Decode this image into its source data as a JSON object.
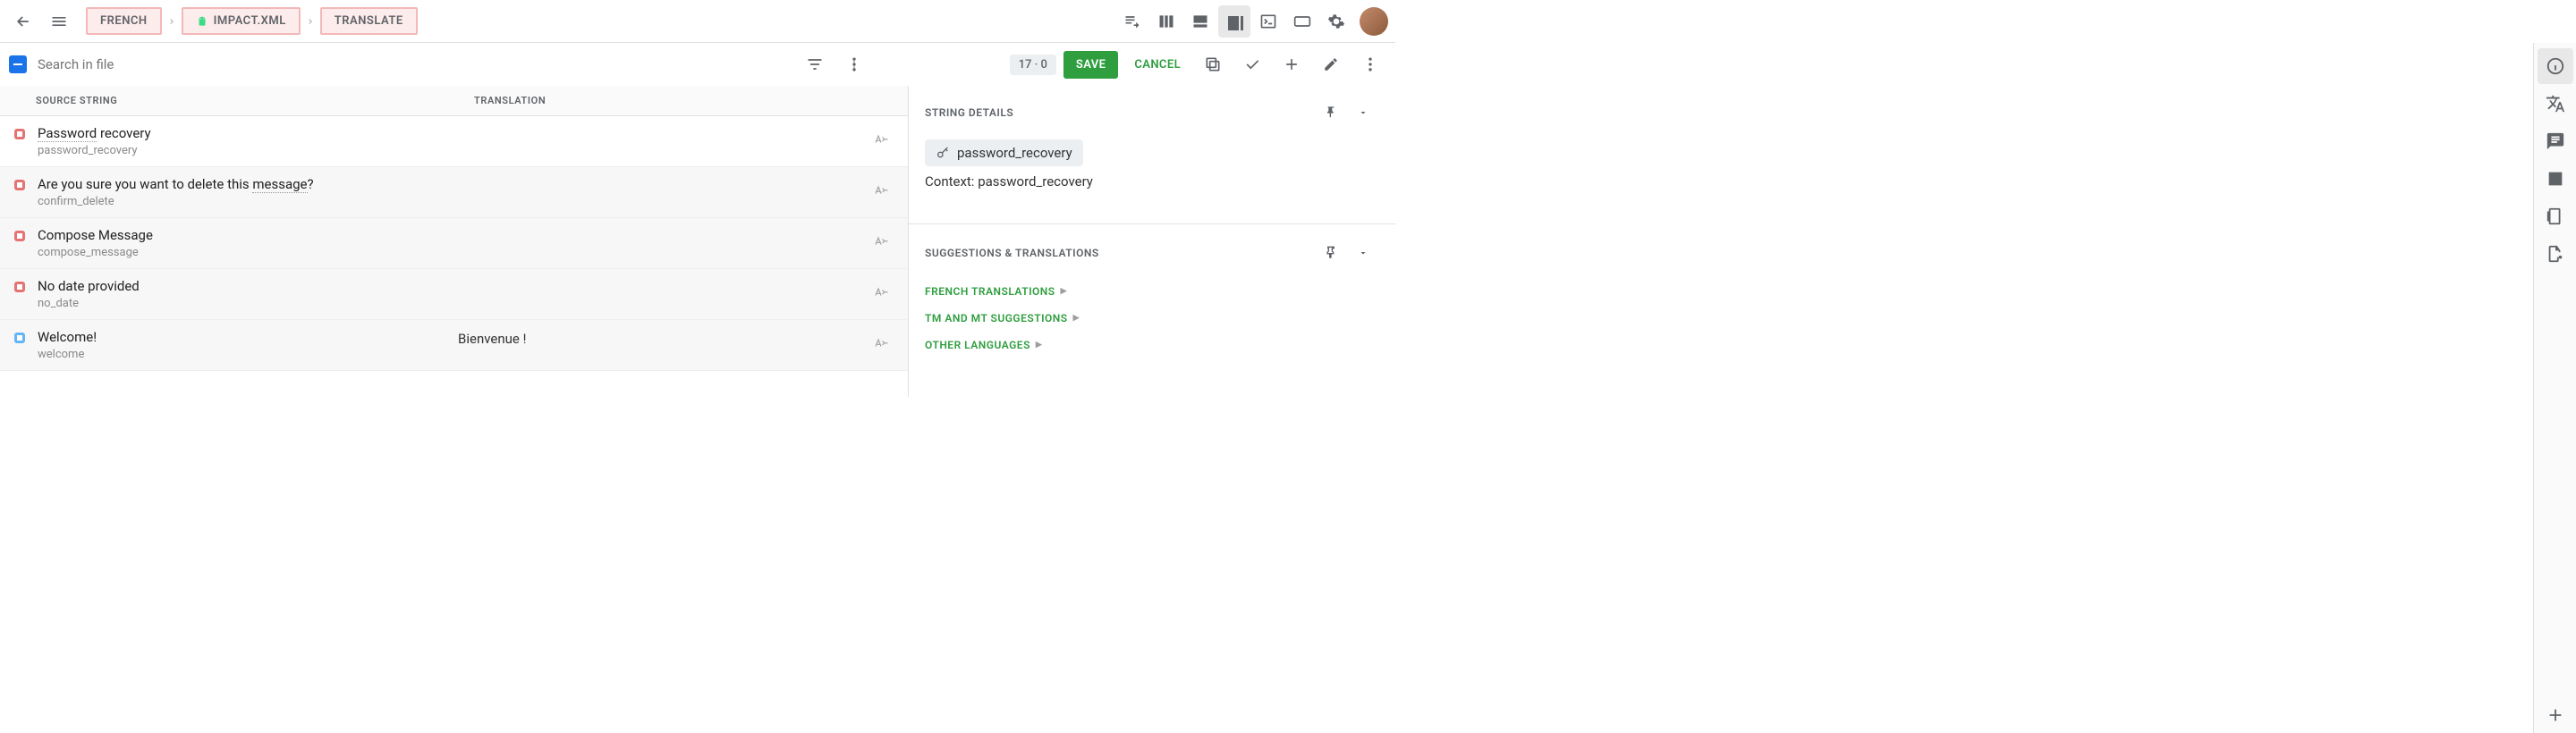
{
  "breadcrumb": {
    "lang": "FRENCH",
    "file": "IMPACT.XML",
    "mode": "TRANSLATE"
  },
  "toolbar": {
    "search_placeholder": "Search in file",
    "count": "17 · 0",
    "save": "SAVE",
    "cancel": "CANCEL"
  },
  "list": {
    "col_source": "SOURCE STRING",
    "col_translation": "TRANSLATION",
    "rows": [
      {
        "status": "red",
        "source_pre": "",
        "source_dotted": "Password",
        "source_post": " recovery",
        "key": "password_recovery",
        "translation": "",
        "selected": true
      },
      {
        "status": "red",
        "source_pre": "Are you sure you want to delete this ",
        "source_dotted": "message",
        "source_post": "?",
        "key": "confirm_delete",
        "translation": "",
        "selected": false
      },
      {
        "status": "red",
        "source_pre": "Compose Message",
        "source_dotted": "",
        "source_post": "",
        "key": "compose_message",
        "translation": "",
        "selected": false
      },
      {
        "status": "red",
        "source_pre": "No date provided",
        "source_dotted": "",
        "source_post": "",
        "key": "no_date",
        "translation": "",
        "selected": false
      },
      {
        "status": "blue",
        "source_pre": "Welcome!",
        "source_dotted": "",
        "source_post": "",
        "key": "welcome",
        "translation": "Bienvenue !",
        "selected": false
      }
    ]
  },
  "details": {
    "title": "STRING DETAILS",
    "key": "password_recovery",
    "context_label": "Context:",
    "context_value": "password_recovery"
  },
  "suggestions": {
    "title": "SUGGESTIONS & TRANSLATIONS",
    "links": [
      "FRENCH TRANSLATIONS",
      "TM AND MT SUGGESTIONS",
      "OTHER LANGUAGES"
    ]
  }
}
